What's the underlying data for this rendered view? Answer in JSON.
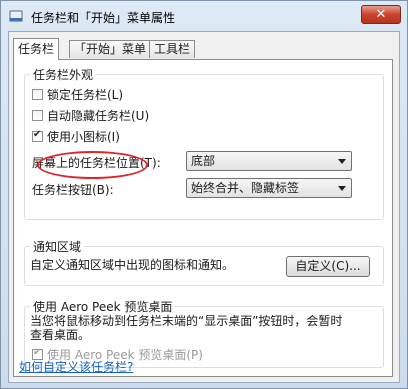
{
  "window": {
    "title": "任务栏和「开始」菜单属性",
    "close_label": "✕",
    "app_icon": "taskbar-icon"
  },
  "tabs": [
    {
      "label": "任务栏",
      "active": true
    },
    {
      "label": "「开始」菜单",
      "active": false
    },
    {
      "label": "工具栏",
      "active": false
    }
  ],
  "appearance": {
    "title": "任务栏外观",
    "lock": {
      "label": "锁定任务栏(L)",
      "checked": false
    },
    "autohide": {
      "label": "自动隐藏任务栏(U)",
      "checked": false
    },
    "small_icons": {
      "label": "使用小图标(I)",
      "checked": true
    },
    "location": {
      "label": "屏幕上的任务栏位置(T):",
      "value": "底部"
    },
    "buttons": {
      "label": "任务栏按钮(B):",
      "value": "始终合并、隐藏标签"
    }
  },
  "notification": {
    "title": "通知区域",
    "desc": "自定义通知区域中出现的图标和通知。",
    "customize_label": "自定义(C)..."
  },
  "peek": {
    "title": "使用 Aero Peek 预览桌面",
    "desc_line1": "当您将鼠标移动到任务栏末端的“显示桌面”按钮时，会暂时",
    "desc_line2": "查看桌面。",
    "checkbox": {
      "label": "使用 Aero Peek 预览桌面(P)",
      "checked": true,
      "disabled": true
    }
  },
  "footer": {
    "link": "如何自定义该任务栏?"
  },
  "colors": {
    "highlight_ring": "#e0232b",
    "link": "#1560c8"
  }
}
